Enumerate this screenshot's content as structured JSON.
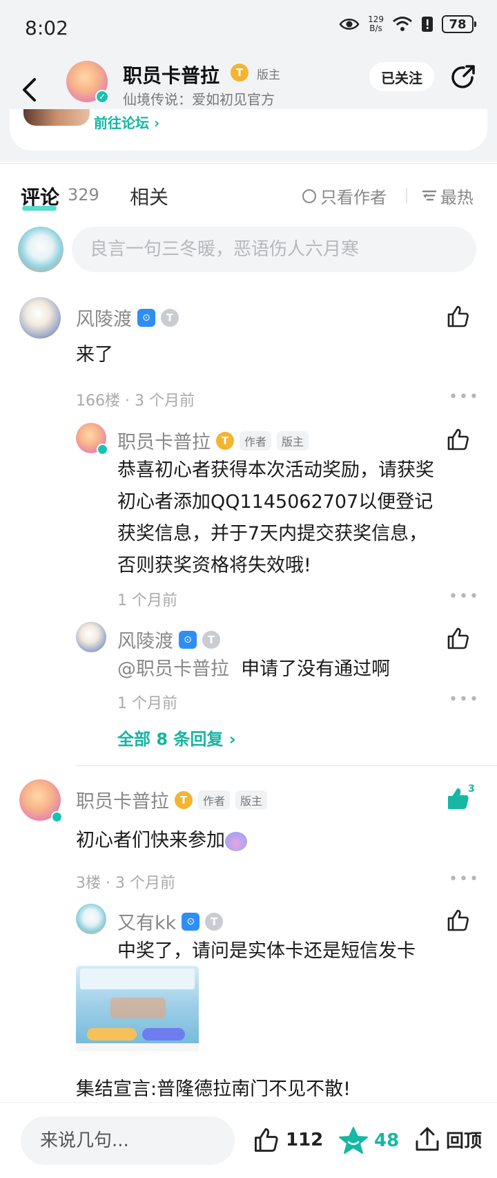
{
  "status_bar": {
    "time": "8:02",
    "net_speed_value": "129",
    "net_speed_unit": "B/s",
    "battery": "78"
  },
  "header": {
    "name": "职员卡普拉",
    "level_badge": "T",
    "role": "版主",
    "subtitle": "仙境传说：爱如初见官方",
    "follow_label": "已关注",
    "forum_link": "前往论坛 ›"
  },
  "tabs": {
    "comments_label": "评论",
    "comments_count": "329",
    "related_label": "相关",
    "only_author_label": "只看作者",
    "sort_label": "最热"
  },
  "input": {
    "placeholder": "良言一句三冬暖，恶语伤人六月寒"
  },
  "comments": [
    {
      "user": "风陵渡",
      "game_badge": "⊙",
      "level_badge": "T",
      "text": "来了",
      "meta": "166楼 · 3 个月前",
      "replies": [
        {
          "user": "职员卡普拉",
          "level_badge": "T",
          "tag_author": "作者",
          "tag_role": "版主",
          "lines": [
            "恭喜初心者获得本次活动奖励，请获奖",
            "初心者添加QQ1145062707以便登记",
            "获奖信息，并于7天内提交获奖信息，",
            "否则获奖资格将失效哦!"
          ],
          "meta": "1 个月前"
        },
        {
          "user": "风陵渡",
          "game_badge": "⊙",
          "level_badge": "T",
          "mention": "@职员卡普拉",
          "text": "申请了没有通过啊",
          "meta": "1 个月前"
        }
      ],
      "all_replies_label": "全部 8 条回复 ›"
    },
    {
      "user": "职员卡普拉",
      "level_badge": "T",
      "tag_author": "作者",
      "tag_role": "版主",
      "text": "初心者们快来参加",
      "like_count": "3",
      "meta": "3楼 · 3 个月前",
      "replies": [
        {
          "user": "又有kk",
          "game_badge": "⊙",
          "level_badge": "T",
          "text": "中奖了，请问是实体卡还是短信发卡"
        }
      ],
      "tail_text": "集结宣言:普隆德拉南门不见不散!"
    }
  ],
  "bottom_bar": {
    "input_placeholder": "来说几句...",
    "like_count": "112",
    "star_count": "48",
    "top_label": "回顶"
  },
  "colors": {
    "accent": "#16b7a3",
    "badge_gold": "#f2b531",
    "game_blue": "#2f8ef3"
  }
}
